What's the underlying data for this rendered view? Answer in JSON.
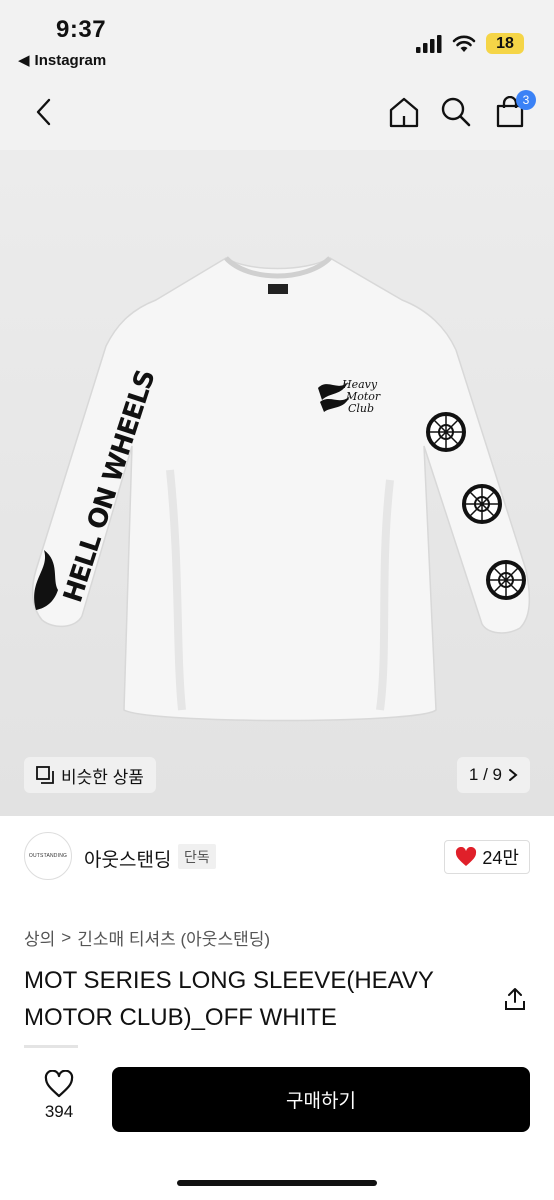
{
  "status_bar": {
    "time": "9:37",
    "back_app": "Instagram",
    "battery": "18",
    "battery_color": "#f5d547"
  },
  "nav": {
    "back_icon": "chevron-left-icon",
    "home_icon": "home-icon",
    "search_icon": "search-icon",
    "cart_icon": "shopping-bag-icon",
    "cart_count": "3",
    "badge_color": "#3b82f6"
  },
  "gallery": {
    "similar_label": "비슷한 상품",
    "page_indicator": "1 / 9",
    "sleeve_print_left": "HELL ON WHEELS",
    "chest_print": [
      "Heavy",
      "Motor",
      "Club"
    ]
  },
  "brand": {
    "logo_text": "OUTSTANDING",
    "name": "아웃스탠딩",
    "tag": "단독",
    "likes": "24만"
  },
  "product": {
    "category": [
      "상의",
      "긴소매 티셔츠 (아웃스탠딩)"
    ],
    "title": "MOT SERIES LONG SLEEVE(HEAVY MOTOR CLUB)_OFF WHITE"
  },
  "bottom_bar": {
    "wish_count": "394",
    "buy_label": "구매하기"
  }
}
